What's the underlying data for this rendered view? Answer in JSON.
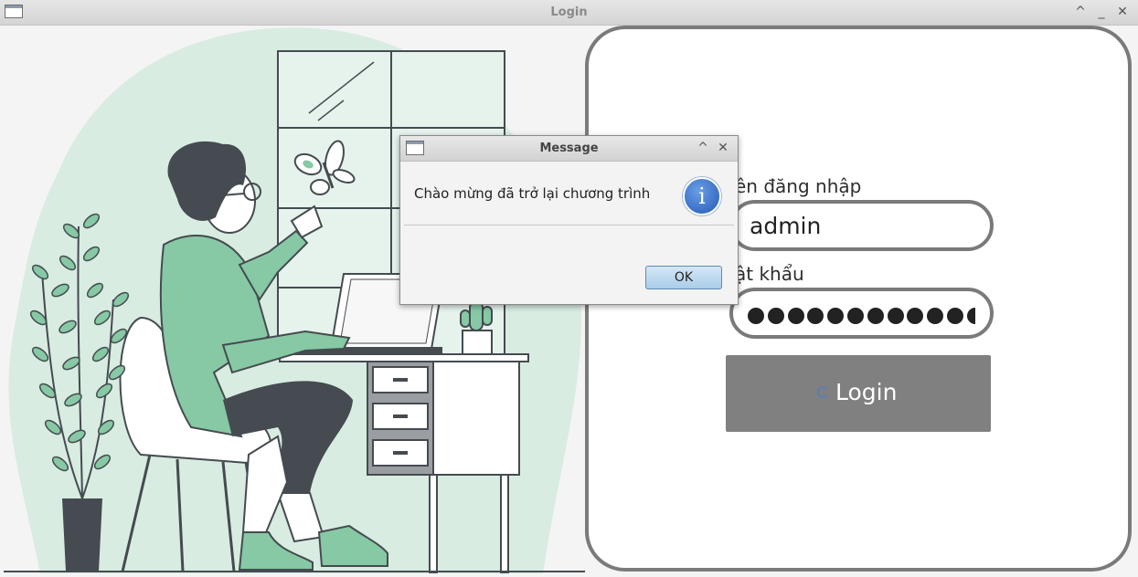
{
  "window": {
    "title": "Login",
    "buttons": [
      "^",
      "_",
      "✕"
    ]
  },
  "login_form": {
    "username_label": "ên đăng nhập",
    "username_value": "admin",
    "password_label": "ật khẩu",
    "password_dot_count": 13,
    "login_button_label": "Login"
  },
  "dialog": {
    "title": "Message",
    "message": "Chào mừng đã trở lại chương trình",
    "info_icon_glyph": "i",
    "ok_label": "OK",
    "title_buttons": [
      "^",
      "✕"
    ]
  },
  "colors": {
    "illustration_blob": "#d8ece2",
    "illustration_green": "#86c9a4",
    "illustration_dark": "#454b50",
    "card_border": "#7a7a7a",
    "login_button": "#808080"
  }
}
